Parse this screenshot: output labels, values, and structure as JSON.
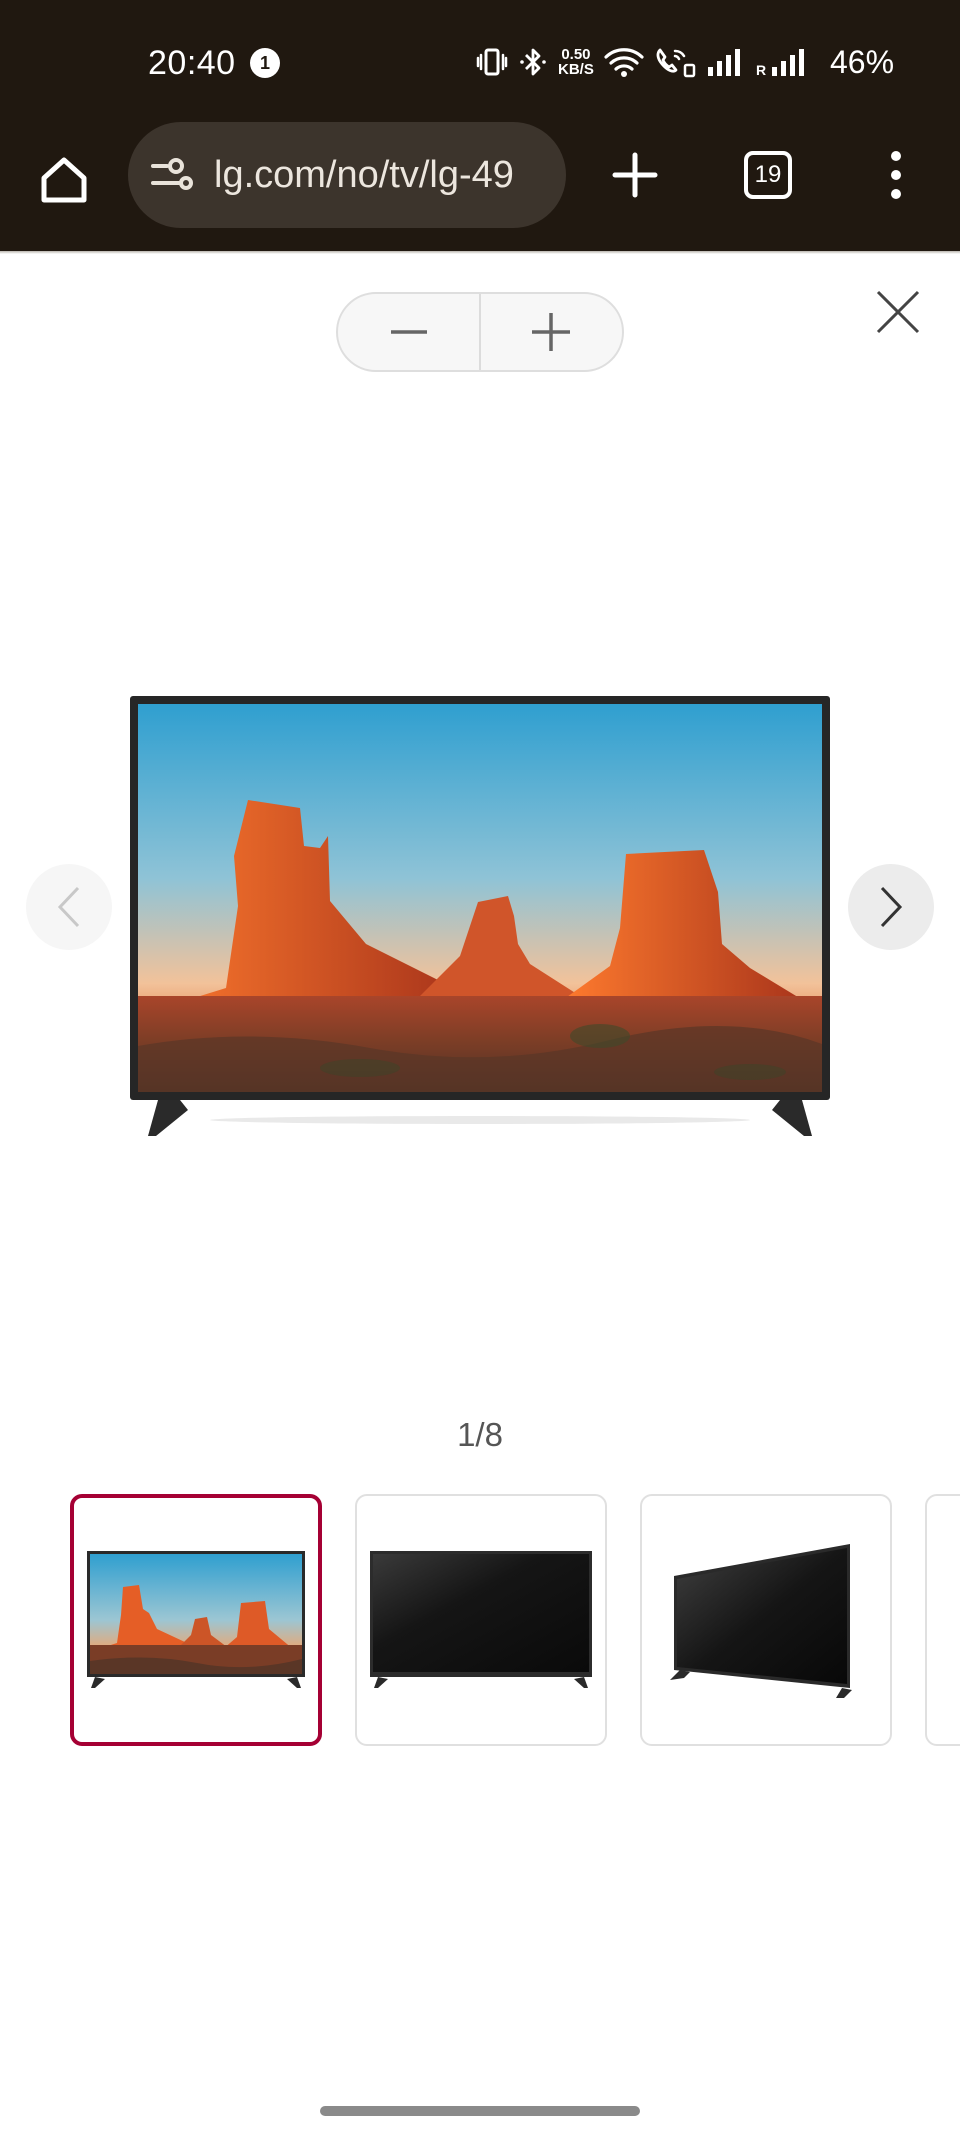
{
  "status_bar": {
    "time": "20:40",
    "notification_count": "1",
    "net_speed_value": "0.50",
    "net_speed_unit": "KB/S",
    "battery": "46%"
  },
  "browser": {
    "url": "lg.com/no/tv/lg-49",
    "tab_count": "19",
    "home_icon": "home-icon",
    "site_settings_icon": "tune-icon",
    "new_tab_icon": "plus-icon",
    "menu_icon": "more-vert-icon"
  },
  "gallery": {
    "zoom_out_icon": "minus-icon",
    "zoom_in_icon": "plus-icon",
    "close_icon": "close-icon",
    "prev_icon": "chevron-left-icon",
    "next_icon": "chevron-right-icon",
    "counter": "1/8",
    "thumbnails": [
      {
        "view": "front-with-landscape",
        "selected": true
      },
      {
        "view": "front-black-screen",
        "selected": false
      },
      {
        "view": "angled-left-black-screen",
        "selected": false
      }
    ],
    "accent_color": "#a50034"
  }
}
